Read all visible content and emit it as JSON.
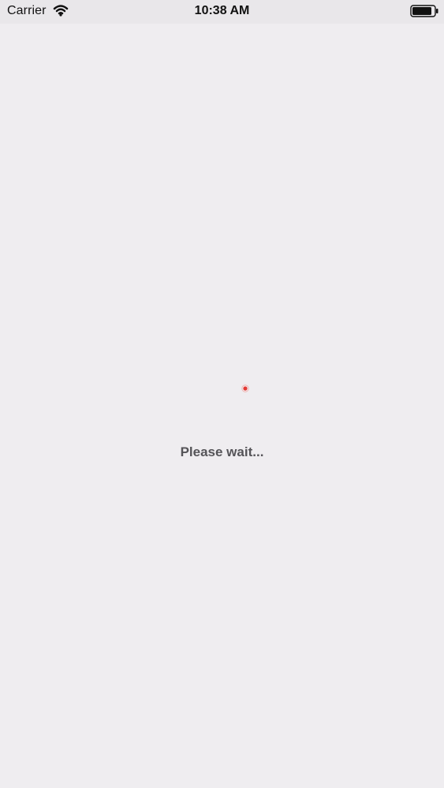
{
  "status_bar": {
    "carrier": "Carrier",
    "time": "10:38 AM",
    "wifi_icon": "wifi-icon",
    "battery_icon": "battery-icon"
  },
  "loader": {
    "text": "Please wait...",
    "spinner_icon": "spinner-icon",
    "spinner_color": "#e53935"
  },
  "colors": {
    "background": "#efedf0",
    "status_bar_background": "#e9e7ea",
    "text": "#555458"
  }
}
